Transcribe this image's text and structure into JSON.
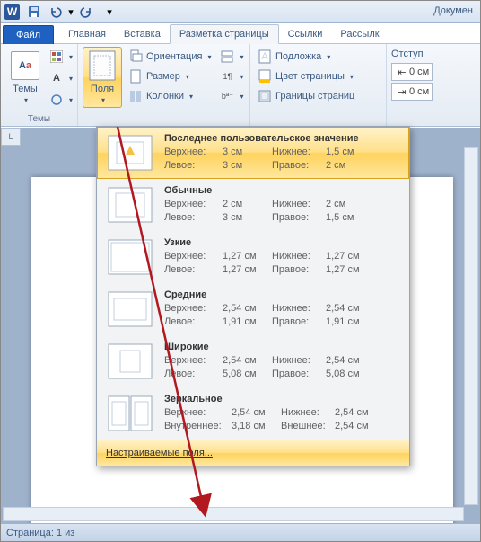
{
  "title_suffix": "Докумен",
  "tabs": {
    "file": "Файл",
    "home": "Главная",
    "insert": "Вставка",
    "layout": "Разметка страницы",
    "refs": "Ссылки",
    "mail": "Рассылк"
  },
  "groups": {
    "themes": {
      "button": "Темы",
      "label": "Темы"
    },
    "page_setup": {
      "margins": "Поля",
      "orientation": "Ориентация",
      "size": "Размер",
      "columns": "Колонки"
    },
    "background": {
      "watermark": "Подложка",
      "color": "Цвет страницы",
      "borders": "Границы страниц"
    },
    "paragraph": {
      "indent": "Отступ",
      "val1": "0 см",
      "val2": "0 см"
    }
  },
  "margins_menu": {
    "last": {
      "title": "Последнее пользовательское значение",
      "topL": "Верхнее:",
      "top": "3 см",
      "botL": "Нижнее:",
      "bot": "1,5 см",
      "leftL": "Левое:",
      "left": "3 см",
      "rightL": "Правое:",
      "right": "2 см"
    },
    "normal": {
      "title": "Обычные",
      "topL": "Верхнее:",
      "top": "2 см",
      "botL": "Нижнее:",
      "bot": "2 см",
      "leftL": "Левое:",
      "left": "3 см",
      "rightL": "Правое:",
      "right": "1,5 см"
    },
    "narrow": {
      "title": "Узкие",
      "topL": "Верхнее:",
      "top": "1,27 см",
      "botL": "Нижнее:",
      "bot": "1,27 см",
      "leftL": "Левое:",
      "left": "1,27 см",
      "rightL": "Правое:",
      "right": "1,27 см"
    },
    "moderate": {
      "title": "Средние",
      "topL": "Верхнее:",
      "top": "2,54 см",
      "botL": "Нижнее:",
      "bot": "2,54 см",
      "leftL": "Левое:",
      "left": "1,91 см",
      "rightL": "Правое:",
      "right": "1,91 см"
    },
    "wide": {
      "title": "Широкие",
      "topL": "Верхнее:",
      "top": "2,54 см",
      "botL": "Нижнее:",
      "bot": "2,54 см",
      "leftL": "Левое:",
      "left": "5,08 см",
      "rightL": "Правое:",
      "right": "5,08 см"
    },
    "mirror": {
      "title": "Зеркальное",
      "topL": "Верхнее:",
      "top": "2,54 см",
      "botL": "Нижнее:",
      "bot": "2,54 см",
      "leftL": "Внутреннее:",
      "left": "3,18 см",
      "rightL": "Внешнее:",
      "right": "2,54 см"
    },
    "custom": "Настраиваемые поля..."
  },
  "status": {
    "page": "Страница: 1 из"
  },
  "ruler_corner": "L"
}
